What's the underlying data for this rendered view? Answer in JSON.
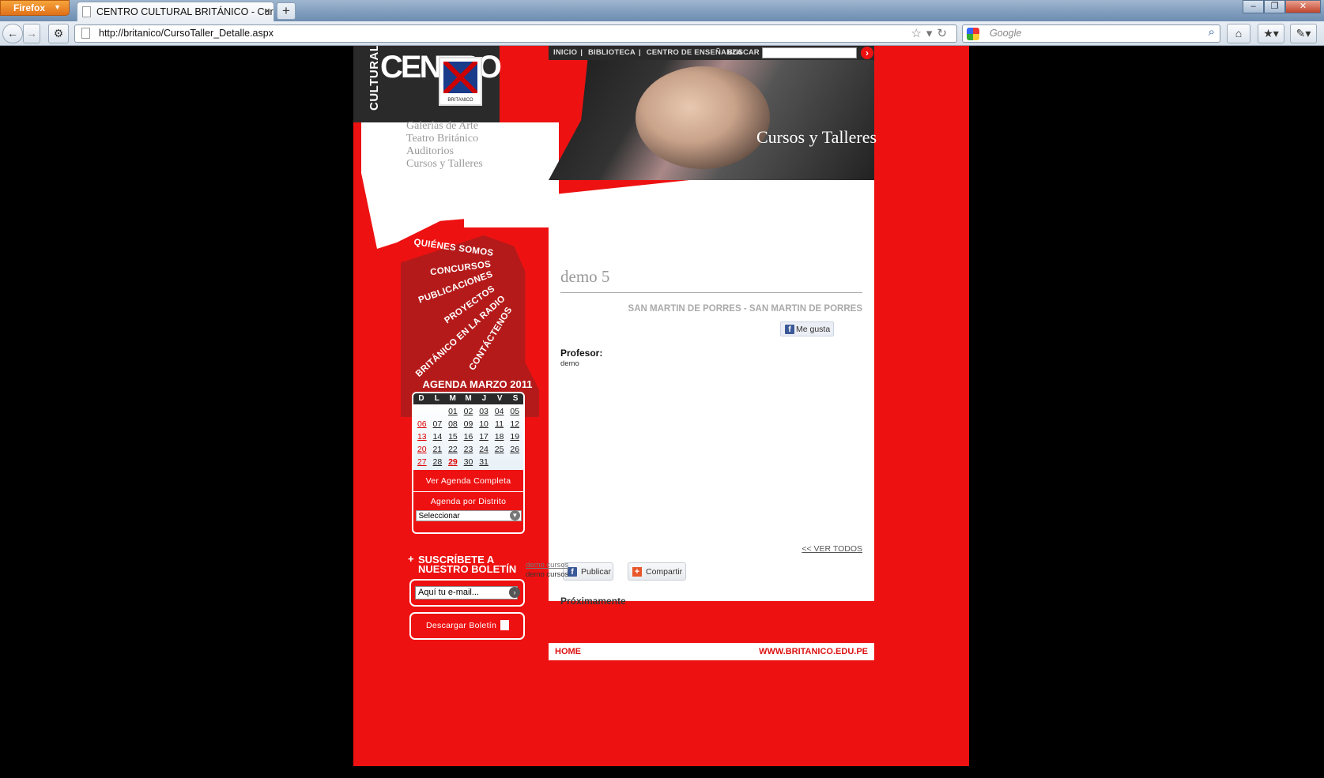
{
  "browser": {
    "app_menu": "Firefox",
    "tab_title": "CENTRO CULTURAL BRITÁNICO - Curso...",
    "new_tab": "+",
    "url": "http://britanico/CursoTaller_Detalle.aspx",
    "search_placeholder": "Google"
  },
  "logo": {
    "cultural": "CULTURAL",
    "centro": "CENTRO",
    "britanico": "BRITANICO"
  },
  "top_nav": {
    "items": [
      "INICIO",
      "BIBLIOTECA",
      "CENTRO DE ENSEÑANZA"
    ],
    "search_label": "BUSCAR"
  },
  "banner_title": "Cursos y Talleres",
  "section_nav": [
    "Galerías de Arte",
    "Teatro Británico",
    "Auditorios",
    "Cursos y Talleres"
  ],
  "left_menu": [
    "QUIÉNES SOMOS",
    "CONCURSOS",
    "PUBLICACIONES",
    "PROYECTOS",
    "BRITÁNICO EN LA RADIO",
    "CONTÁCTENOS"
  ],
  "calendar": {
    "title": "AGENDA MARZO 2011",
    "weekdays": [
      "D",
      "L",
      "M",
      "M",
      "J",
      "V",
      "S"
    ],
    "weeks": [
      [
        "",
        "",
        "01",
        "02",
        "03",
        "04",
        "05"
      ],
      [
        "06",
        "07",
        "08",
        "09",
        "10",
        "11",
        "12"
      ],
      [
        "13",
        "14",
        "15",
        "16",
        "17",
        "18",
        "19"
      ],
      [
        "20",
        "21",
        "22",
        "23",
        "24",
        "25",
        "26"
      ],
      [
        "27",
        "28",
        "29",
        "30",
        "31",
        "",
        ""
      ]
    ],
    "highlighted_day": "29",
    "ver_agenda": "Ver Agenda Completa",
    "agenda_distrito": "Agenda por Distrito",
    "select_value": "Seleccionar"
  },
  "newsletter": {
    "line1": "SUSCRÍBETE A",
    "line2": "NUESTRO BOLETÍN",
    "email_placeholder": "Aquí tu e-mail...",
    "download": "Descargar Boletín"
  },
  "content": {
    "title": "demo 5",
    "location": "SAN MARTIN DE PORRES - SAN MARTIN DE PORRES",
    "like": "Me gusta",
    "profesor_label": "Profesor:",
    "profesor_value": "demo",
    "ver_todos": "<< VER TODOS",
    "publicar": "Publicar",
    "compartir": "Compartir",
    "proximamente": "Próximamente",
    "prox_link": "demo cursos",
    "prox_text": "demo cursos"
  },
  "footer": {
    "home": "HOME",
    "url": "WWW.BRITANICO.EDU.PE"
  }
}
